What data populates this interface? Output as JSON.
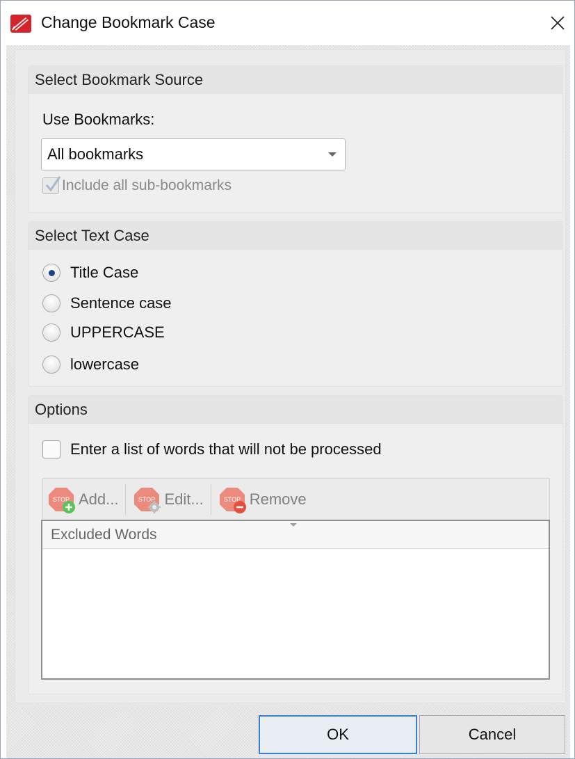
{
  "window": {
    "title": "Change Bookmark Case",
    "icons": {
      "app": "app-logo-icon",
      "close": "close-icon"
    }
  },
  "source_group": {
    "header": "Select Bookmark Source",
    "use_bookmarks_label": "Use Bookmarks:",
    "dropdown_value": "All bookmarks",
    "include_sub_label": "Include all sub-bookmarks",
    "include_sub_checked": true,
    "include_sub_disabled": true
  },
  "case_group": {
    "header": "Select Text Case",
    "options": [
      {
        "label": "Title Case",
        "checked": true
      },
      {
        "label": "Sentence case",
        "checked": false
      },
      {
        "label": "UPPERCASE",
        "checked": false
      },
      {
        "label": "lowercase",
        "checked": false
      }
    ]
  },
  "options_group": {
    "header": "Options",
    "exclude_checkbox_label": "Enter a list of words that will not be processed",
    "exclude_checked": false,
    "toolbar": {
      "add_label": "Add...",
      "edit_label": "Edit...",
      "remove_label": "Remove",
      "stop_text": "STOP"
    },
    "list_column_header": "Excluded Words",
    "list_items": []
  },
  "footer": {
    "ok_label": "OK",
    "cancel_label": "Cancel"
  },
  "colors": {
    "accent": "#3a7fd0",
    "radio_selected": "#1b3f8c",
    "app_icon_red": "#d4232a",
    "stop_icon": "#e8786b"
  }
}
